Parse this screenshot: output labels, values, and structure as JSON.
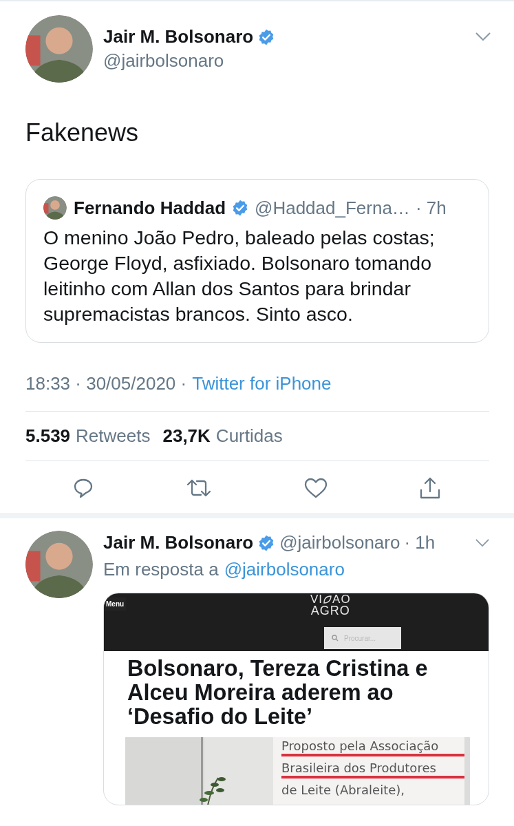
{
  "tweet": {
    "author": {
      "name": "Jair M. Bolsonaro",
      "verified": true,
      "handle": "@jairbolsonaro"
    },
    "text": "Fakenews",
    "quoted": {
      "name": "Fernando Haddad",
      "verified": true,
      "handle": "@Haddad_Ferna…",
      "time": "· 7h",
      "text": "O menino João Pedro, baleado pelas costas; George Floyd, asfixiado. Bolsonaro tomando leitinho com Allan dos Santos para brindar supremacistas brancos. Sinto asco."
    },
    "timestamp": "18:33 · 30/05/2020 ·",
    "source": "Twitter for iPhone",
    "stats": [
      {
        "count": "5.539",
        "label": "Retweets"
      },
      {
        "count": "23,7K",
        "label": "Curtidas"
      }
    ]
  },
  "reply": {
    "author": {
      "name": "Jair M. Bolsonaro",
      "verified": true,
      "handle": "@jairbolsonaro"
    },
    "time": "· 1h",
    "reply_label": "Em resposta a",
    "reply_to": "@jairbolsonaro",
    "attachment": {
      "menu": "Menu",
      "logo_left": "VI",
      "logo_right": "AO",
      "logo_bottom": "AGRO",
      "search_placeholder": "Procurar...",
      "headline_lines": [
        "Bolsonaro, Tereza Cristina e",
        "Alceu Moreira aderem ao",
        "‘Desafio do Leite’"
      ],
      "body_lines": [
        {
          "text": "Proposto pela Associação",
          "underlined": true
        },
        {
          "text": "Brasileira dos Produtores",
          "underlined": true
        },
        {
          "text": "de Leite (Abraleite),",
          "underlined": false
        }
      ]
    }
  }
}
